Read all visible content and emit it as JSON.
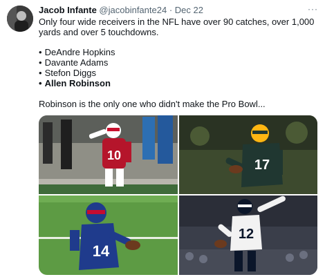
{
  "tweet": {
    "author_name": "Jacob Infante",
    "handle": "@jacobinfante24",
    "separator": "·",
    "date": "Dec 22",
    "more_label": "···",
    "intro": "Only four wide receivers in the NFL have over 90 catches, over 1,000 yards and over 5 touchdowns.",
    "bullets": [
      {
        "marker": "•",
        "text": "DeAndre Hopkins"
      },
      {
        "marker": "•",
        "text": "Davante Adams"
      },
      {
        "marker": "•",
        "text": "Stefon Diggs"
      },
      {
        "marker": "•",
        "text": "Allen Robinson"
      }
    ],
    "closing": "Robinson is the only one who didn't make the Pro Bowl..."
  },
  "media": {
    "photos": [
      {
        "subject": "Cardinals receiver",
        "jersey": "10"
      },
      {
        "subject": "Packers receiver",
        "jersey": "17"
      },
      {
        "subject": "Bills receiver",
        "jersey": "14"
      },
      {
        "subject": "Bears receiver",
        "jersey": "12"
      }
    ]
  }
}
